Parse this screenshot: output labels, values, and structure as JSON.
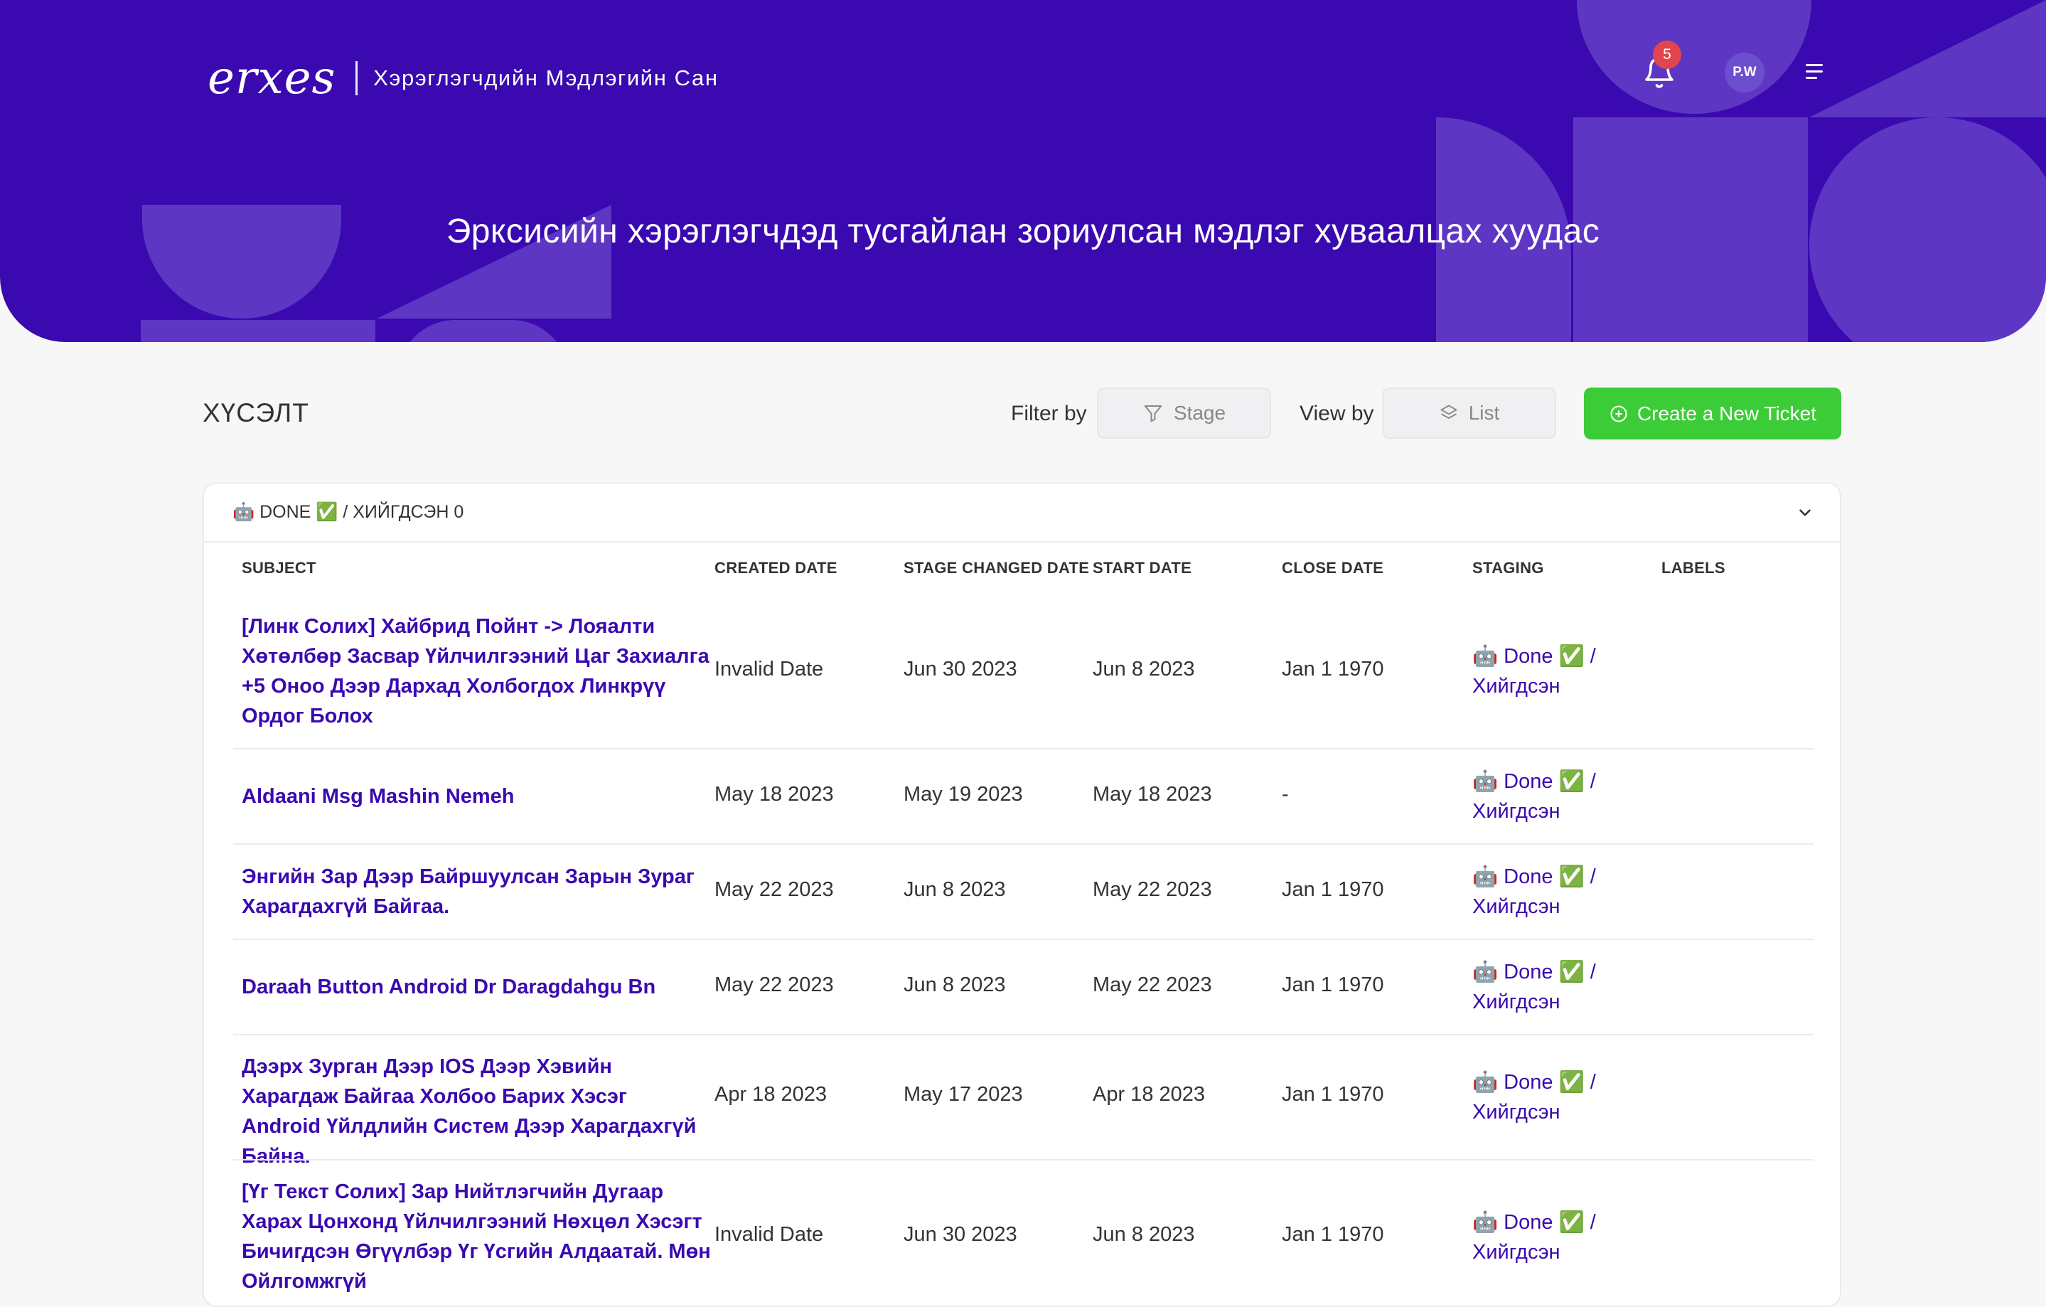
{
  "header": {
    "logo": "erxes",
    "brand_title": "Хэрэглэгчдийн Мэдлэгийн Сан",
    "notification_count": "5",
    "avatar_initials": "P.W",
    "hero_text": "Эрксисийн хэрэглэгчдэд тусгайлан зориулсан мэдлэг хуваалцах хуудас"
  },
  "toolbar": {
    "page_title": "ХҮСЭЛТ",
    "filter_label": "Filter by",
    "filter_value": "Stage",
    "view_label": "View by",
    "view_value": "List",
    "create_label": "Create a New Ticket"
  },
  "group": {
    "title": "🤖 DONE ✅ / ХИЙГДСЭН 0"
  },
  "table": {
    "columns": [
      "SUBJECT",
      "CREATED DATE",
      "STAGE CHANGED DATE",
      "START DATE",
      "CLOSE DATE",
      "STAGING",
      "LABELS"
    ],
    "rows": [
      {
        "subject": "[Линк Солих] Хайбрид Пойнт -> Лояалти Хөтөлбөр Засвар Үйлчилгээний Цаг Захиалга +5 Оноо Дээр Дархад Холбогдох Линкрүү Ордог Болох",
        "created": "Invalid Date",
        "stage_changed": "Jun 30 2023",
        "start": "Jun 8 2023",
        "close": "Jan 1 1970",
        "staging": "🤖 Done ✅ / Хийгдсэн"
      },
      {
        "subject": "Aldaani Msg Mashin Nemeh",
        "created": "May 18 2023",
        "stage_changed": "May 19 2023",
        "start": "May 18 2023",
        "close": "-",
        "staging": "🤖 Done ✅ / Хийгдсэн"
      },
      {
        "subject": "Энгийн Зар Дээр Байршуулсан Зарын Зураг Харагдахгүй Байгаа.",
        "created": "May 22 2023",
        "stage_changed": "Jun 8 2023",
        "start": "May 22 2023",
        "close": "Jan 1 1970",
        "staging": "🤖 Done ✅ / Хийгдсэн"
      },
      {
        "subject": "Daraah Button Android Dr Daragdahgu Bn",
        "created": "May 22 2023",
        "stage_changed": "Jun 8 2023",
        "start": "May 22 2023",
        "close": "Jan 1 1970",
        "staging": "🤖 Done ✅ / Хийгдсэн"
      },
      {
        "subject": "Дээрх Зурган Дээр IOS Дээр Хэвийн Харагдаж Байгаа Холбоо Барих Хэсэг Android Үйлдлийн Систем Дээр Харагдахгүй Байна.",
        "created": "Apr 18 2023",
        "stage_changed": "May 17 2023",
        "start": "Apr 18 2023",
        "close": "Jan 1 1970",
        "staging": "🤖 Done ✅ / Хийгдсэн"
      },
      {
        "subject": "[Үг Текст Солих] Зар Нийтлэгчийн Дугаар Харах Цонхонд Үйлчилгээний Нөхцөл Хэсэгт Бичигдсэн Өгүүлбэр Үг Үсгийн Алдаатай. Мөн Ойлгомжгүй",
        "created": "Invalid Date",
        "stage_changed": "Jun 30 2023",
        "start": "Jun 8 2023",
        "close": "Jan 1 1970",
        "staging": "🤖 Done ✅ / Хийгдсэн"
      }
    ]
  },
  "colors": {
    "brand_purple": "#3a0ab0",
    "shape_purple": "#5e36c4",
    "create_green": "#3ccc38",
    "badge_red": "#e2454e"
  },
  "icons": [
    "bell-icon",
    "menu-icon",
    "filter-icon",
    "layers-icon",
    "plus-circle-icon",
    "chevron-down-icon"
  ]
}
